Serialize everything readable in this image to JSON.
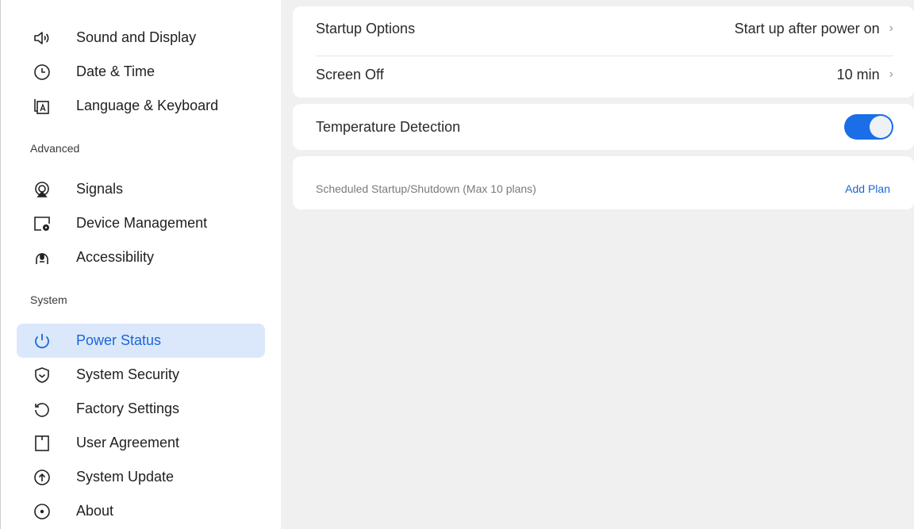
{
  "sidebar": {
    "group1": [
      {
        "label": "Sound and Display",
        "icon": "speaker-icon"
      },
      {
        "label": "Date & Time",
        "icon": "clock-icon"
      },
      {
        "label": "Language & Keyboard",
        "icon": "language-icon"
      }
    ],
    "advanced_header": "Advanced",
    "advanced": [
      {
        "label": "Signals",
        "icon": "signal-icon"
      },
      {
        "label": "Device Management",
        "icon": "device-gear-icon"
      },
      {
        "label": "Accessibility",
        "icon": "accessibility-icon"
      }
    ],
    "system_header": "System",
    "system": [
      {
        "label": "Power Status",
        "icon": "power-icon",
        "selected": true
      },
      {
        "label": "System Security",
        "icon": "shield-icon"
      },
      {
        "label": "Factory Settings",
        "icon": "reset-icon"
      },
      {
        "label": "User Agreement",
        "icon": "document-icon"
      },
      {
        "label": "System Update",
        "icon": "update-icon"
      },
      {
        "label": "About",
        "icon": "info-icon"
      }
    ]
  },
  "main": {
    "startup_label": "Startup Options",
    "startup_value": "Start up after power on",
    "screen_off_label": "Screen Off",
    "screen_off_value": "10 min",
    "temp_label": "Temperature Detection",
    "temp_enabled": true,
    "schedule_label": "Scheduled Startup/Shutdown (Max 10 plans)",
    "add_plan": "Add Plan"
  },
  "colors": {
    "accent": "#1a6ee8",
    "selected_bg": "#dbe8fb"
  }
}
